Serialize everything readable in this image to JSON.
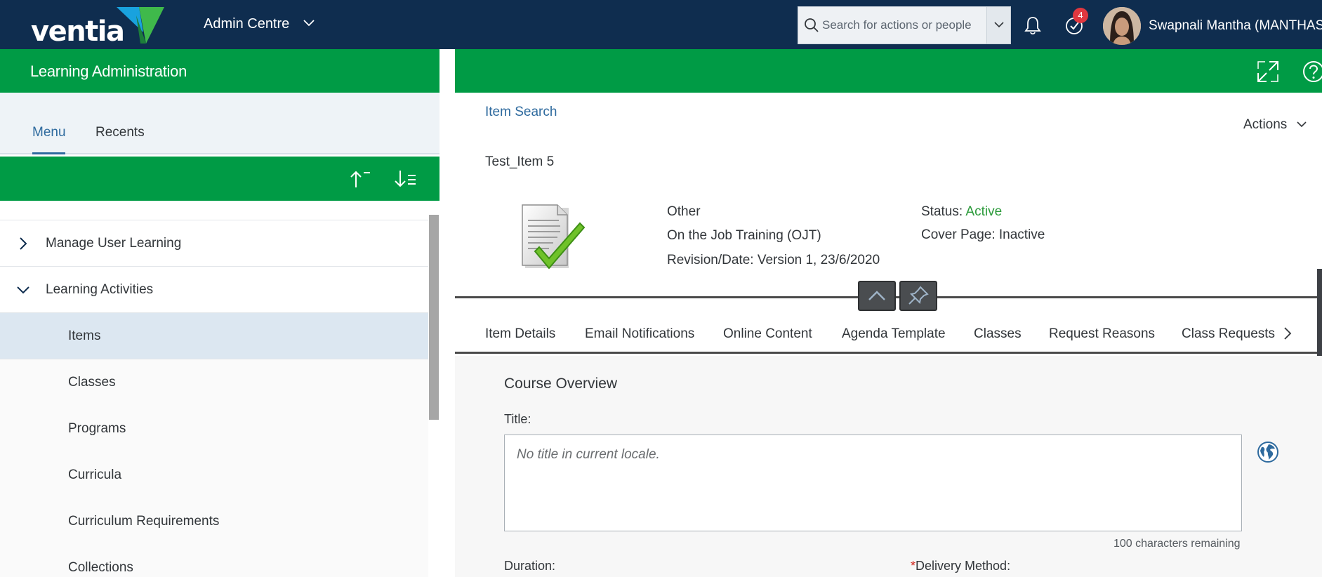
{
  "shell": {
    "logo_text": "ventia",
    "app_switcher": "Admin Centre",
    "search_placeholder": "Search for actions or people",
    "notification_count": "4",
    "user_name": "Swapnali Mantha (MANTHAS)"
  },
  "left_panel": {
    "title": "Learning Administration",
    "tabs": [
      {
        "label": "Menu",
        "active": true
      },
      {
        "label": "Recents",
        "active": false
      }
    ],
    "menu": [
      {
        "label": "Manage User Learning",
        "state": "collapsed"
      },
      {
        "label": "Learning Activities",
        "state": "expanded"
      },
      {
        "label": "Items",
        "selected": true
      },
      {
        "label": "Classes"
      },
      {
        "label": "Programs"
      },
      {
        "label": "Curricula"
      },
      {
        "label": "Curriculum Requirements"
      },
      {
        "label": "Collections"
      }
    ]
  },
  "right_panel": {
    "breadcrumb": "Item Search",
    "actions_label": "Actions",
    "item_name": "Test_Item 5",
    "item_type": "Other",
    "delivery_type": "On the Job Training (OJT)",
    "revision": "Revision/Date: Version 1, 23/6/2020",
    "status_label": "Status:",
    "status_value": "Active",
    "cover_page": "Cover Page: Inactive",
    "tabs": [
      "Item Details",
      "Email Notifications",
      "Online Content",
      "Agenda Template",
      "Classes",
      "Request Reasons",
      "Class Requests"
    ],
    "section_title": "Course Overview",
    "title_label": "Title:",
    "title_placeholder": "No title in current locale.",
    "chars_remaining": "100 characters remaining",
    "duration_label": "Duration:",
    "delivery_method_label": "Delivery Method:"
  },
  "colors": {
    "shell_bg": "#0f2d4f",
    "brand_green": "#009b45",
    "link_blue": "#2e6a9e",
    "status_green": "#2b9a3a",
    "badge_red": "#e0373f"
  }
}
